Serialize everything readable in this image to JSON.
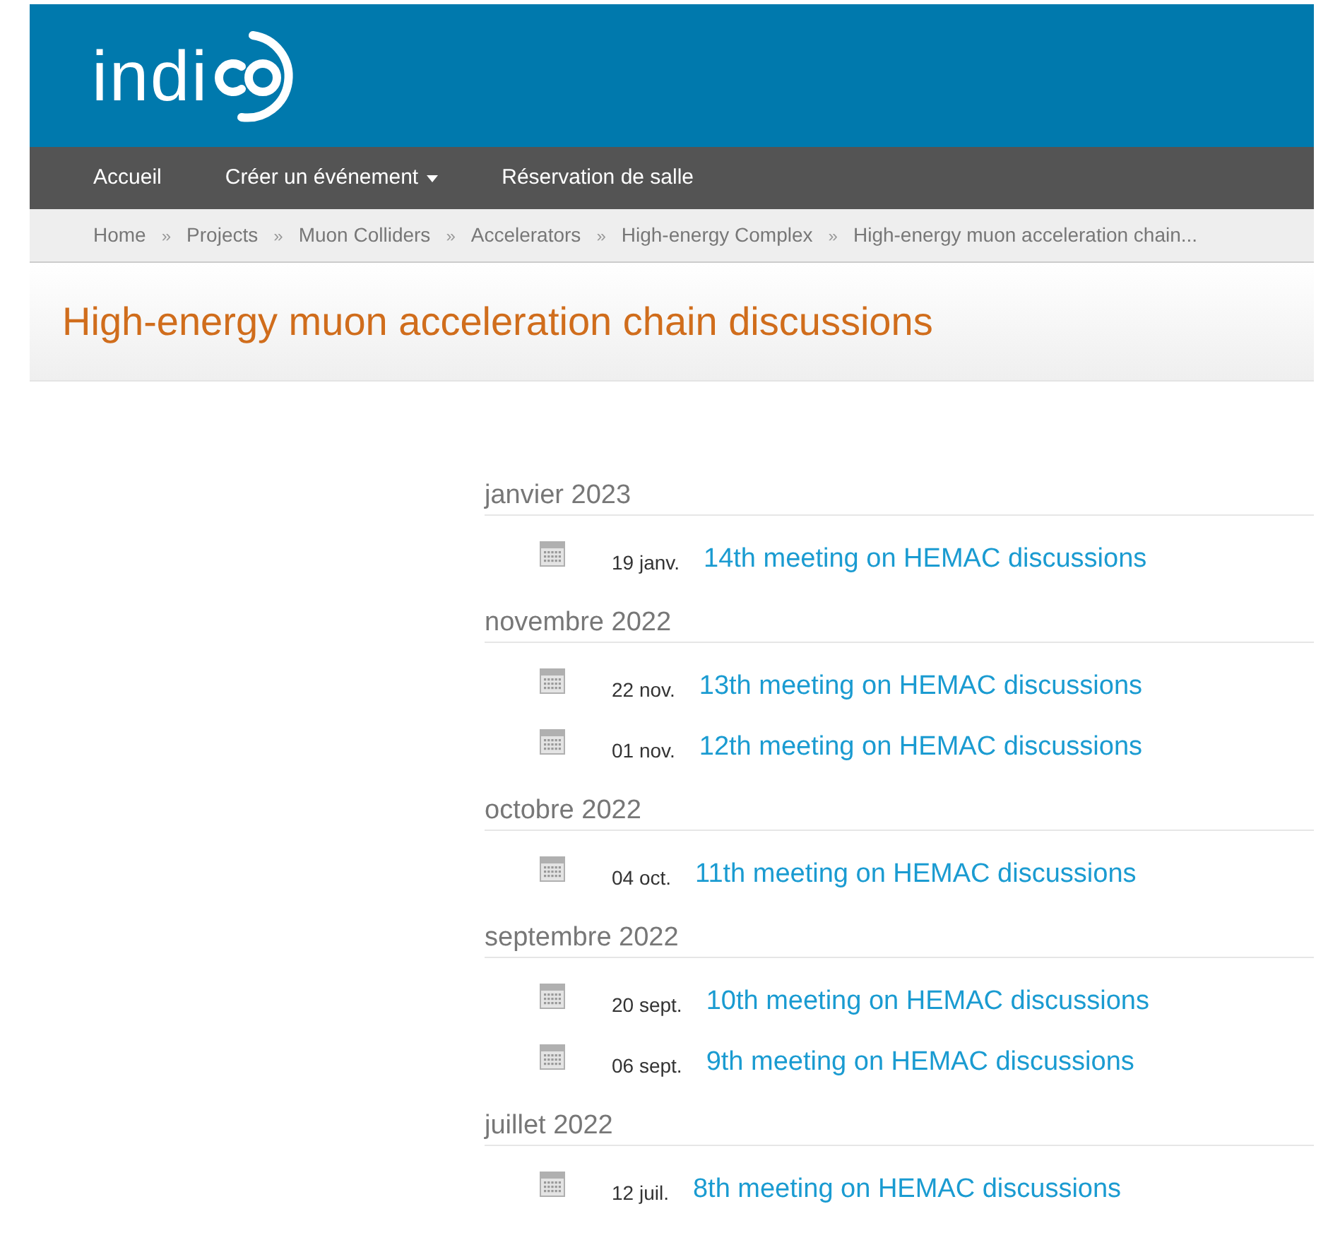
{
  "logo": {
    "text": "indi"
  },
  "nav": [
    {
      "label": "Accueil",
      "dropdown": false
    },
    {
      "label": "Créer un événement",
      "dropdown": true
    },
    {
      "label": "Réservation de salle",
      "dropdown": false
    }
  ],
  "breadcrumb": [
    "Home",
    "Projects",
    "Muon Colliders",
    "Accelerators",
    "High-energy Complex",
    "High-energy muon acceleration chain..."
  ],
  "breadcrumb_separator": "»",
  "title": "High-energy muon acceleration chain discussions",
  "months": [
    {
      "label": "janvier 2023",
      "events": [
        {
          "date": "19 janv.",
          "title": "14th meeting on HEMAC discussions"
        }
      ]
    },
    {
      "label": "novembre 2022",
      "events": [
        {
          "date": "22 nov.",
          "title": "13th meeting on HEMAC discussions"
        },
        {
          "date": "01 nov.",
          "title": "12th meeting on HEMAC discussions"
        }
      ]
    },
    {
      "label": "octobre 2022",
      "events": [
        {
          "date": "04 oct.",
          "title": "11th meeting on HEMAC discussions"
        }
      ]
    },
    {
      "label": "septembre 2022",
      "events": [
        {
          "date": "20 sept.",
          "title": "10th meeting on HEMAC discussions"
        },
        {
          "date": "06 sept.",
          "title": "9th meeting on HEMAC discussions"
        }
      ]
    },
    {
      "label": "juillet 2022",
      "events": [
        {
          "date": "12 juil.",
          "title": "8th meeting on HEMAC discussions"
        }
      ]
    }
  ]
}
